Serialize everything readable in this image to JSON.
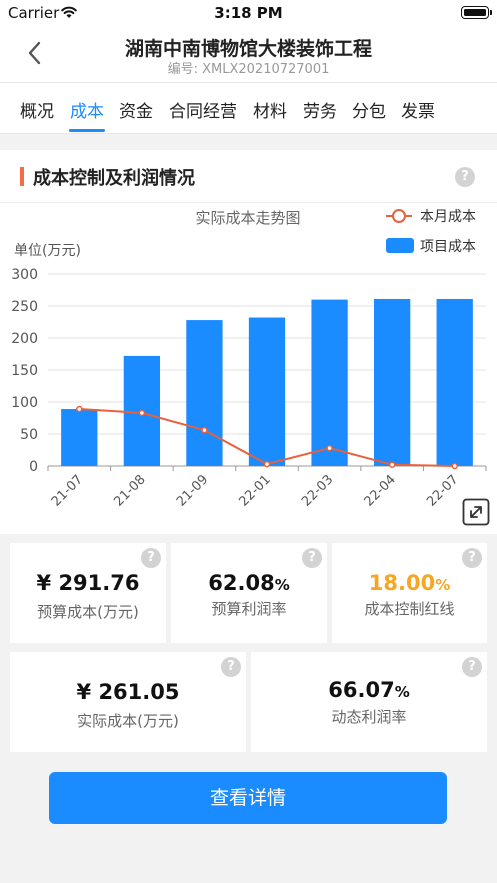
{
  "status": {
    "carrier": "Carrier",
    "time": "3:18 PM"
  },
  "nav": {
    "title": "湖南中南博物馆大楼装饰工程",
    "subtitle": "编号: XMLX20210727001"
  },
  "tabs": [
    "概况",
    "成本",
    "资金",
    "合同经营",
    "材料",
    "劳务",
    "分包",
    "发票"
  ],
  "active_tab": "成本",
  "section": {
    "title": "成本控制及利润情况",
    "help": "?"
  },
  "chart_data": {
    "type": "bar",
    "title": "实际成本走势图",
    "ylabel": "单位(万元)",
    "categories": [
      "21-07",
      "21-08",
      "21-09",
      "22-01",
      "22-03",
      "22-04",
      "22-07"
    ],
    "ylim": [
      0,
      300
    ],
    "yticks": [
      0,
      50,
      100,
      150,
      200,
      250,
      300
    ],
    "series": [
      {
        "name": "项目成本",
        "kind": "bar",
        "color": "#1a8cff",
        "values": [
          89,
          172,
          228,
          232,
          260,
          261,
          261
        ]
      },
      {
        "name": "本月成本",
        "kind": "line",
        "color": "#e8603c",
        "values": [
          89,
          83,
          56,
          3,
          28,
          2,
          0
        ]
      }
    ],
    "legend": "top-right",
    "grid": true
  },
  "stats": [
    {
      "value": "¥ 291.76",
      "label": "预算成本(万元)",
      "color": "#111111"
    },
    {
      "value": "62.08",
      "unit": "%",
      "label": "预算利润率",
      "color": "#111111"
    },
    {
      "value": "18.00",
      "unit": "%",
      "label": "成本控制红线",
      "color": "#f5a623"
    },
    {
      "value": "¥ 261.05",
      "label": "实际成本(万元)",
      "color": "#111111"
    },
    {
      "value": "66.07",
      "unit": "%",
      "label": "动态利润率",
      "color": "#111111"
    }
  ],
  "button": {
    "label": "查看详情"
  }
}
